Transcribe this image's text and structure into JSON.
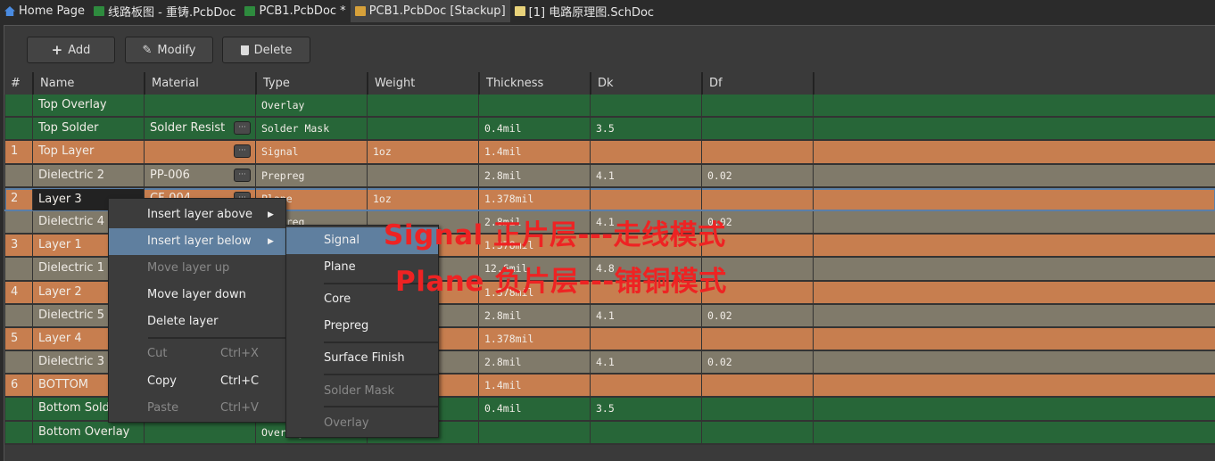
{
  "tabs": [
    {
      "label": "Home Page",
      "icon": "home-icon",
      "color": "#4a8be0"
    },
    {
      "label": "线路板图 - 重铸.PcbDoc",
      "icon": "pcb-icon",
      "color": "#2e8b3e"
    },
    {
      "label": "PCB1.PcbDoc *",
      "icon": "pcb-icon",
      "color": "#2e8b3e"
    },
    {
      "label": "PCB1.PcbDoc [Stackup]",
      "icon": "stackup-icon",
      "color": "#d7a13a",
      "active": true
    },
    {
      "label": "[1] 电路原理图.SchDoc",
      "icon": "schematic-icon",
      "color": "#e8d27a"
    }
  ],
  "toolbar": {
    "add": "Add",
    "modify": "Modify",
    "delete": "Delete"
  },
  "columns": [
    "#",
    "Name",
    "Material",
    "Type",
    "Weight",
    "Thickness",
    "Dk",
    "Df"
  ],
  "rows": [
    {
      "num": "",
      "name": "Top Overlay",
      "material": "",
      "dots": false,
      "type": "Overlay",
      "weight": "",
      "thickness": "",
      "dk": "",
      "df": "",
      "kind": "g"
    },
    {
      "num": "",
      "name": "Top Solder",
      "material": "Solder Resist",
      "dots": true,
      "type": "Solder Mask",
      "weight": "",
      "thickness": "0.4mil",
      "dk": "3.5",
      "df": "",
      "kind": "g"
    },
    {
      "num": "1",
      "name": "Top Layer",
      "material": "",
      "dots": true,
      "type": "Signal",
      "weight": "1oz",
      "thickness": "1.4mil",
      "dk": "",
      "df": "",
      "kind": "o"
    },
    {
      "num": "",
      "name": "Dielectric 2",
      "material": "PP-006",
      "dots": true,
      "type": "Prepreg",
      "weight": "",
      "thickness": "2.8mil",
      "dk": "4.1",
      "df": "0.02",
      "kind": "d"
    },
    {
      "num": "2",
      "name": "Layer 3",
      "material": "CF-004",
      "dots": true,
      "type": "Plane",
      "weight": "1oz",
      "thickness": "1.378mil",
      "dk": "",
      "df": "",
      "kind": "o",
      "selected": true
    },
    {
      "num": "",
      "name": "Dielectric 4",
      "material": "",
      "dots": false,
      "type": "Prepreg",
      "weight": "",
      "thickness": "2.8mil",
      "dk": "4.1",
      "df": "0.02",
      "kind": "d"
    },
    {
      "num": "3",
      "name": "Layer 1",
      "material": "",
      "dots": false,
      "type": "",
      "weight": "",
      "thickness": "1.378mil",
      "dk": "",
      "df": "",
      "kind": "o"
    },
    {
      "num": "",
      "name": "Dielectric 1",
      "material": "",
      "dots": false,
      "type": "",
      "weight": "",
      "thickness": "12.6mil",
      "dk": "4.8",
      "df": "",
      "kind": "d"
    },
    {
      "num": "4",
      "name": "Layer 2",
      "material": "",
      "dots": false,
      "type": "",
      "weight": "",
      "thickness": "1.378mil",
      "dk": "",
      "df": "",
      "kind": "o"
    },
    {
      "num": "",
      "name": "Dielectric 5",
      "material": "",
      "dots": false,
      "type": "",
      "weight": "",
      "thickness": "2.8mil",
      "dk": "4.1",
      "df": "0.02",
      "kind": "d"
    },
    {
      "num": "5",
      "name": "Layer 4",
      "material": "",
      "dots": false,
      "type": "",
      "weight": "",
      "thickness": "1.378mil",
      "dk": "",
      "df": "",
      "kind": "o"
    },
    {
      "num": "",
      "name": "Dielectric 3",
      "material": "",
      "dots": false,
      "type": "",
      "weight": "",
      "thickness": "2.8mil",
      "dk": "4.1",
      "df": "0.02",
      "kind": "d"
    },
    {
      "num": "6",
      "name": "BOTTOM",
      "material": "",
      "dots": false,
      "type": "",
      "weight": "",
      "thickness": "1.4mil",
      "dk": "",
      "df": "",
      "kind": "o"
    },
    {
      "num": "",
      "name": "Bottom Solder",
      "material": "",
      "dots": false,
      "type": "",
      "weight": "",
      "thickness": "0.4mil",
      "dk": "3.5",
      "df": "",
      "kind": "g"
    },
    {
      "num": "",
      "name": "Bottom Overlay",
      "material": "",
      "dots": false,
      "type": "Overlay",
      "weight": "",
      "thickness": "",
      "dk": "",
      "df": "",
      "kind": "g"
    }
  ],
  "context_menu": [
    {
      "label": "Insert layer above",
      "submenu": true
    },
    {
      "label": "Insert layer below",
      "submenu": true,
      "highlighted": true
    },
    {
      "label": "Move layer up",
      "disabled": true
    },
    {
      "label": "Move layer down"
    },
    {
      "label": "Delete layer"
    },
    {
      "label": "Cut",
      "shortcut": "Ctrl+X",
      "disabled": true
    },
    {
      "label": "Copy",
      "shortcut": "Ctrl+C"
    },
    {
      "label": "Paste",
      "shortcut": "Ctrl+V",
      "disabled": true
    }
  ],
  "submenu": [
    {
      "label": "Signal",
      "highlighted": true
    },
    {
      "label": "Plane"
    },
    {
      "label": "Core"
    },
    {
      "label": "Prepreg"
    },
    {
      "label": "Surface Finish"
    },
    {
      "label": "Solder Mask",
      "disabled": true
    },
    {
      "label": "Overlay",
      "disabled": true
    }
  ],
  "annotations": [
    "Signal 正片层---走线模式",
    "Plane 负片层---铺铜模式"
  ],
  "colors": {
    "signal_row": "#c77e4f",
    "dielectric_row": "#807a6a",
    "mask_row": "#276638",
    "menu_highlight": "#5f7f9f",
    "annotation": "#ee2323"
  }
}
